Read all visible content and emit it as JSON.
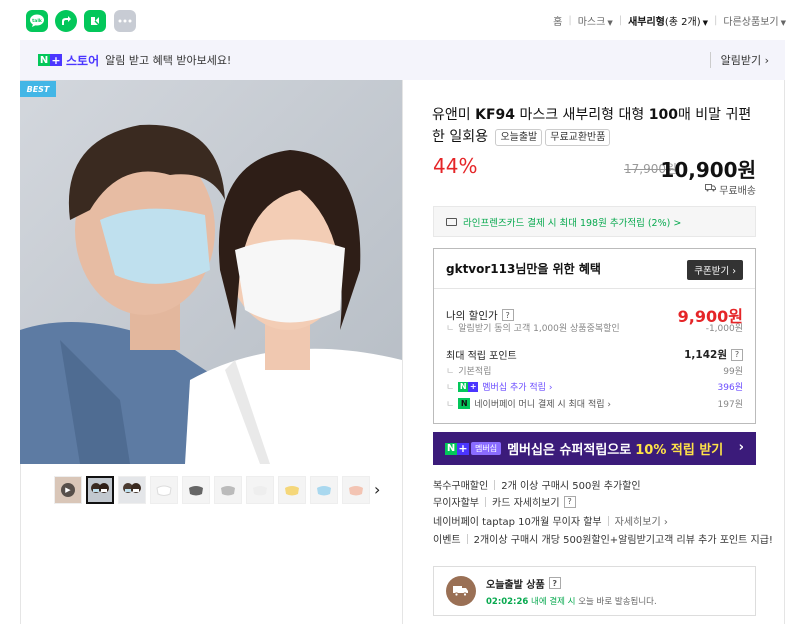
{
  "topbar": {
    "icons": [
      "talk-icon",
      "share-icon",
      "store-icon",
      "more-icon"
    ],
    "talk_label": "talk",
    "breadcrumb": {
      "home": "홈",
      "category": "마스크",
      "current": "새부리형",
      "current_count": "(총 2개)",
      "other": "다른상품보기"
    }
  },
  "banner": {
    "store_name": "스토어",
    "message": "알림 받고 혜택 받아보세요!",
    "alarm_label": "알림받기 ›"
  },
  "product": {
    "badge": "BEST",
    "title_prefix": "유앤미 ",
    "title_bold": "KF94",
    "title_mid": " 마스크 새부리형 대형 ",
    "title_bold2": "100",
    "title_suffix": "매 비말 귀편한 일회용",
    "tag_today": "오늘출발",
    "tag_free_return": "무료교환반품",
    "discount": "44%",
    "original_price": "17,900원",
    "sale_price": "10,900원",
    "shipping": "무료배송"
  },
  "card_benefit": "라인프렌즈카드 결제 시 최대 198원 추가적립 (2%) >",
  "benefit": {
    "header": "gktvor113님만을 위한 혜택",
    "coupon_button": "쿠폰받기 ›",
    "my_discount_label": "나의 할인가",
    "my_discount_value": "9,900원",
    "alarm_coupon_label": "알림받기 동의 고객 1,000원 상품중복할인",
    "alarm_coupon_value": "-1,000원",
    "max_points_label": "최대 적립 포인트",
    "max_points_value": "1,142원",
    "basic_label": "기본적립",
    "basic_value": "99원",
    "membership_label": "멤버십 추가 적립 ›",
    "membership_value": "396원",
    "npay_label": "네이버페이 머니 결제 시 최대 적립 ›",
    "npay_value": "197원"
  },
  "member_banner": {
    "pill": "멤버십",
    "text": "멤버십은 슈퍼적립으로",
    "highlight": "10% 적립 받기",
    "arrow": "›"
  },
  "info_rows": [
    {
      "label": "복수구매할인",
      "value": "2개 이상 구매시 500원 추가할인",
      "extra": ""
    },
    {
      "label": "무이자할부",
      "value": "카드 자세히보기",
      "extra": "?"
    },
    {
      "label": "네이버페이 taptap 10개월 무이자 할부",
      "value": "자세히보기 ›",
      "extra": ""
    },
    {
      "label": "이벤트",
      "value": "2개이상 구매시 개당 500원할인+알림받기고객 리뷰 추가 포인트 지급!",
      "extra": ""
    }
  ],
  "delivery": {
    "title": "오늘출발 상품",
    "time": "02:02:26",
    "time_suffix": "내에 결제 시",
    "message": " 오늘 바로 발송됩니다."
  },
  "colors": {
    "naver_green": "#03c75a",
    "store_purple": "#4b36ff",
    "discount_red": "#e52528",
    "member_banner": "#3b1b7a"
  }
}
